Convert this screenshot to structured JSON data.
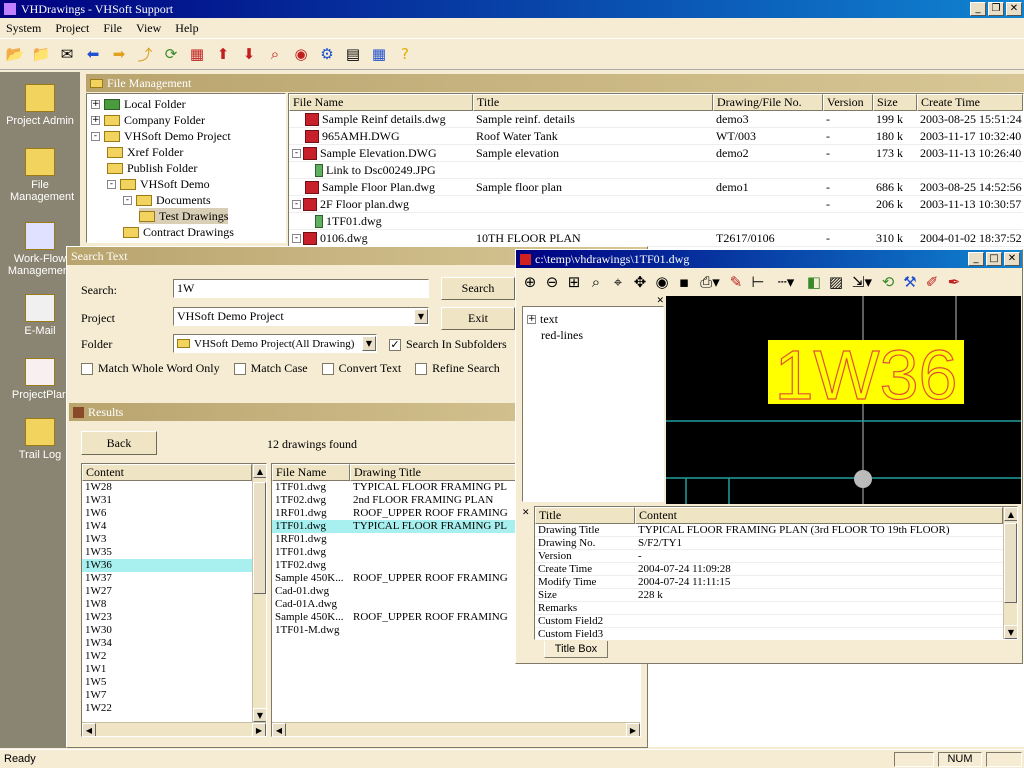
{
  "app": {
    "title": "VHDrawings - VHSoft Support",
    "menu": [
      "System",
      "Project",
      "File",
      "View",
      "Help"
    ],
    "status": "Ready",
    "status_num": "NUM"
  },
  "left_nav": [
    {
      "label": "Project Admin",
      "icon": "project-admin-icon"
    },
    {
      "label": "File Management",
      "icon": "file-management-icon"
    },
    {
      "label": "Work-Flow Management",
      "icon": "workflow-icon"
    },
    {
      "label": "E-Mail",
      "icon": "email-icon"
    },
    {
      "label": "ProjectPlan",
      "icon": "project-plan-icon"
    },
    {
      "label": "Trail Log",
      "icon": "trail-log-icon"
    }
  ],
  "file_mgmt": {
    "caption": "File Management",
    "tree": [
      {
        "label": "Local Folder",
        "level": 0,
        "green": true,
        "expander": "+"
      },
      {
        "label": "Company Folder",
        "level": 0,
        "expander": "+"
      },
      {
        "label": "VHSoft Demo Project",
        "level": 0,
        "expander": "-"
      },
      {
        "label": "Xref Folder",
        "level": 1
      },
      {
        "label": "Publish Folder",
        "level": 1
      },
      {
        "label": "VHSoft Demo",
        "level": 1,
        "expander": "-"
      },
      {
        "label": "Documents",
        "level": 2,
        "expander": "-"
      },
      {
        "label": "Test Drawings",
        "level": 3,
        "selected": true
      },
      {
        "label": "Contract Drawings",
        "level": 2
      }
    ],
    "columns": [
      "File Name",
      "Title",
      "Drawing/File No.",
      "Version",
      "Size",
      "Create Time"
    ],
    "rows": [
      {
        "name": "Sample Reinf details.dwg",
        "title": "Sample reinf. details",
        "no": "demo3",
        "ver": "-",
        "size": "199 k",
        "time": "2003-08-25 15:51:24"
      },
      {
        "name": "965AMH.DWG",
        "title": "Roof Water Tank",
        "no": "WT/003",
        "ver": "-",
        "size": "180 k",
        "time": "2003-11-17 10:32:40"
      },
      {
        "name": "Sample Elevation.DWG",
        "title": "Sample elevation",
        "no": "demo2",
        "ver": "-",
        "size": "173 k",
        "time": "2003-11-13 10:26:40",
        "expander": "-"
      },
      {
        "name": "Link to Dsc00249.JPG",
        "title": "",
        "no": "",
        "ver": "",
        "size": "",
        "time": "",
        "child": true
      },
      {
        "name": "Sample Floor Plan.dwg",
        "title": "Sample floor plan",
        "no": "demo1",
        "ver": "-",
        "size": "686 k",
        "time": "2003-08-25 14:52:56"
      },
      {
        "name": "2F Floor plan.dwg",
        "title": "",
        "no": "",
        "ver": "-",
        "size": "206 k",
        "time": "2003-11-13 10:30:57",
        "expander": "-"
      },
      {
        "name": "1TF01.dwg",
        "title": "",
        "no": "",
        "ver": "",
        "size": "",
        "time": "",
        "child": true
      },
      {
        "name": "0106.dwg",
        "title": "10TH FLOOR PLAN",
        "no": "T2617/0106",
        "ver": "-",
        "size": "310 k",
        "time": "2004-01-02 18:37:52",
        "expander": "-"
      }
    ]
  },
  "search": {
    "caption": "Search Text",
    "search_label": "Search:",
    "search_value": "1W",
    "project_label": "Project",
    "project_value": "VHSoft Demo Project",
    "folder_label": "Folder",
    "folder_value": "VHSoft Demo Project(All Drawing)",
    "subfolders_label": "Search In Subfolders",
    "search_button": "Search",
    "exit_button": "Exit",
    "options": [
      "Match Whole Word Only",
      "Match Case",
      "Convert Text",
      "Refine Search"
    ],
    "results_caption": "Results",
    "back_button": "Back",
    "found_text": "12 drawings found",
    "content_header": "Content",
    "content_items": [
      "1W28",
      "1W31",
      "1W6",
      "1W4",
      "1W3",
      "1W35",
      "1W36",
      "1W37",
      "1W27",
      "1W8",
      "1W23",
      "1W30",
      "1W34",
      "1W2",
      "1W1",
      "1W5",
      "1W7",
      "1W22"
    ],
    "content_selected": "1W36",
    "result_columns": [
      "File Name",
      "Drawing Title"
    ],
    "result_rows": [
      {
        "name": "1TF01.dwg",
        "title": "TYPICAL FLOOR FRAMING PL"
      },
      {
        "name": "1TF02.dwg",
        "title": "2nd FLOOR FRAMING PLAN"
      },
      {
        "name": "1RF01.dwg",
        "title": "ROOF_UPPER ROOF FRAMING"
      },
      {
        "name": "1TF01.dwg",
        "title": "TYPICAL FLOOR FRAMING PL",
        "selected": true
      },
      {
        "name": "1RF01.dwg",
        "title": ""
      },
      {
        "name": "1TF01.dwg",
        "title": ""
      },
      {
        "name": "1TF02.dwg",
        "title": ""
      },
      {
        "name": "Sample 450K...",
        "title": "ROOF_UPPER ROOF FRAMING"
      },
      {
        "name": "Cad-01.dwg",
        "title": ""
      },
      {
        "name": "Cad-01A.dwg",
        "title": ""
      },
      {
        "name": "Sample 450K...",
        "title": "ROOF_UPPER ROOF FRAMING"
      },
      {
        "name": "1TF01-M.dwg",
        "title": ""
      }
    ]
  },
  "viewer": {
    "title": "c:\\temp\\vhdrawings\\1TF01.dwg",
    "layers": [
      {
        "label": "text",
        "expander": "+"
      },
      {
        "label": "red-lines",
        "expander": ""
      }
    ],
    "drawing_text": "1W36",
    "colors": {
      "canvas": "#000000",
      "highlight": "#ffff00",
      "text": "#e05030",
      "lines": "#20a0a0"
    },
    "props_columns": [
      "Title",
      "Content"
    ],
    "props": [
      {
        "k": "Drawing Title",
        "v": "TYPICAL FLOOR FRAMING PLAN (3rd FLOOR TO 19th FLOOR)"
      },
      {
        "k": "Drawing No.",
        "v": "S/F2/TY1"
      },
      {
        "k": "Version",
        "v": "-"
      },
      {
        "k": "Create Time",
        "v": "2004-07-24 11:09:28"
      },
      {
        "k": "Modify Time",
        "v": "2004-07-24 11:11:15"
      },
      {
        "k": "Size",
        "v": "228 k"
      },
      {
        "k": "Remarks",
        "v": ""
      },
      {
        "k": "Custom Field2",
        "v": ""
      },
      {
        "k": "Custom Field3",
        "v": ""
      }
    ],
    "tab_label": "Title Box"
  }
}
